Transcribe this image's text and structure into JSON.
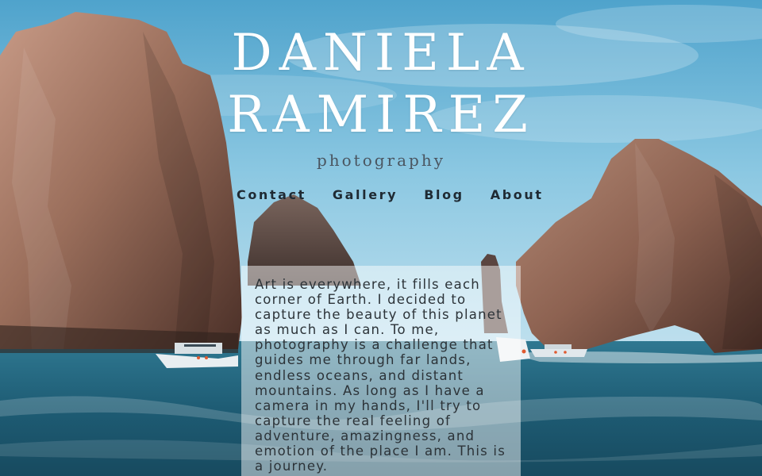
{
  "hero": {
    "title_line1": "DANIELA",
    "title_line2": "RAMIREZ",
    "subtitle": "photography"
  },
  "nav": {
    "items": [
      "Contact",
      "Gallery",
      "Blog",
      "About"
    ]
  },
  "intro": {
    "text": "Art is everywhere, it fills each corner of Earth. I decided to capture the beauty of this planet as much as I can. To me, photography is a challenge that guides me through far lands, endless oceans, and distant mountains. As long as I have a camera in my hands, I'll try to capture the real feeling of adventure, amazingness, and emotion of the place I am. This is a journey."
  },
  "colors": {
    "sky": "#6fb6d6",
    "sea": "#1f5f78",
    "rock": "#9b7260",
    "title": "#ffffff",
    "nav_text": "#1f2a33"
  }
}
